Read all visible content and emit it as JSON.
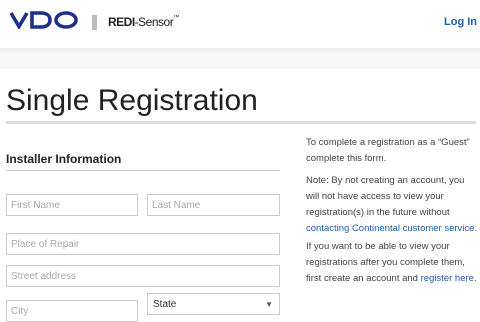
{
  "header": {
    "brand": "VDO",
    "product_bold": "REDI",
    "product_rest": "-Sensor",
    "product_tm": "™",
    "login_label": "Log In"
  },
  "colors": {
    "brand_blue": "#1e2f8c",
    "link_blue": "#1f5fa8"
  },
  "page": {
    "title": "Single Registration"
  },
  "form": {
    "section_title": "Installer Information",
    "first_name_placeholder": "First Name",
    "last_name_placeholder": "Last Name",
    "place_placeholder": "Place of Repair",
    "street_placeholder": "Street address",
    "city_placeholder": "City",
    "state_selected": "State"
  },
  "sidebar": {
    "p1": "To complete a registration as a “Guest” complete this form.",
    "p2_text": "Note: By not creating an account, you will not have access to view your registration(s) in the future without ",
    "p2_link": "contacting Continental customer service",
    "p2_end": ".",
    "p3_text": "If you want to be able to view your registrations after you complete them, first create an account and ",
    "p3_link": "register here",
    "p3_end": "."
  }
}
